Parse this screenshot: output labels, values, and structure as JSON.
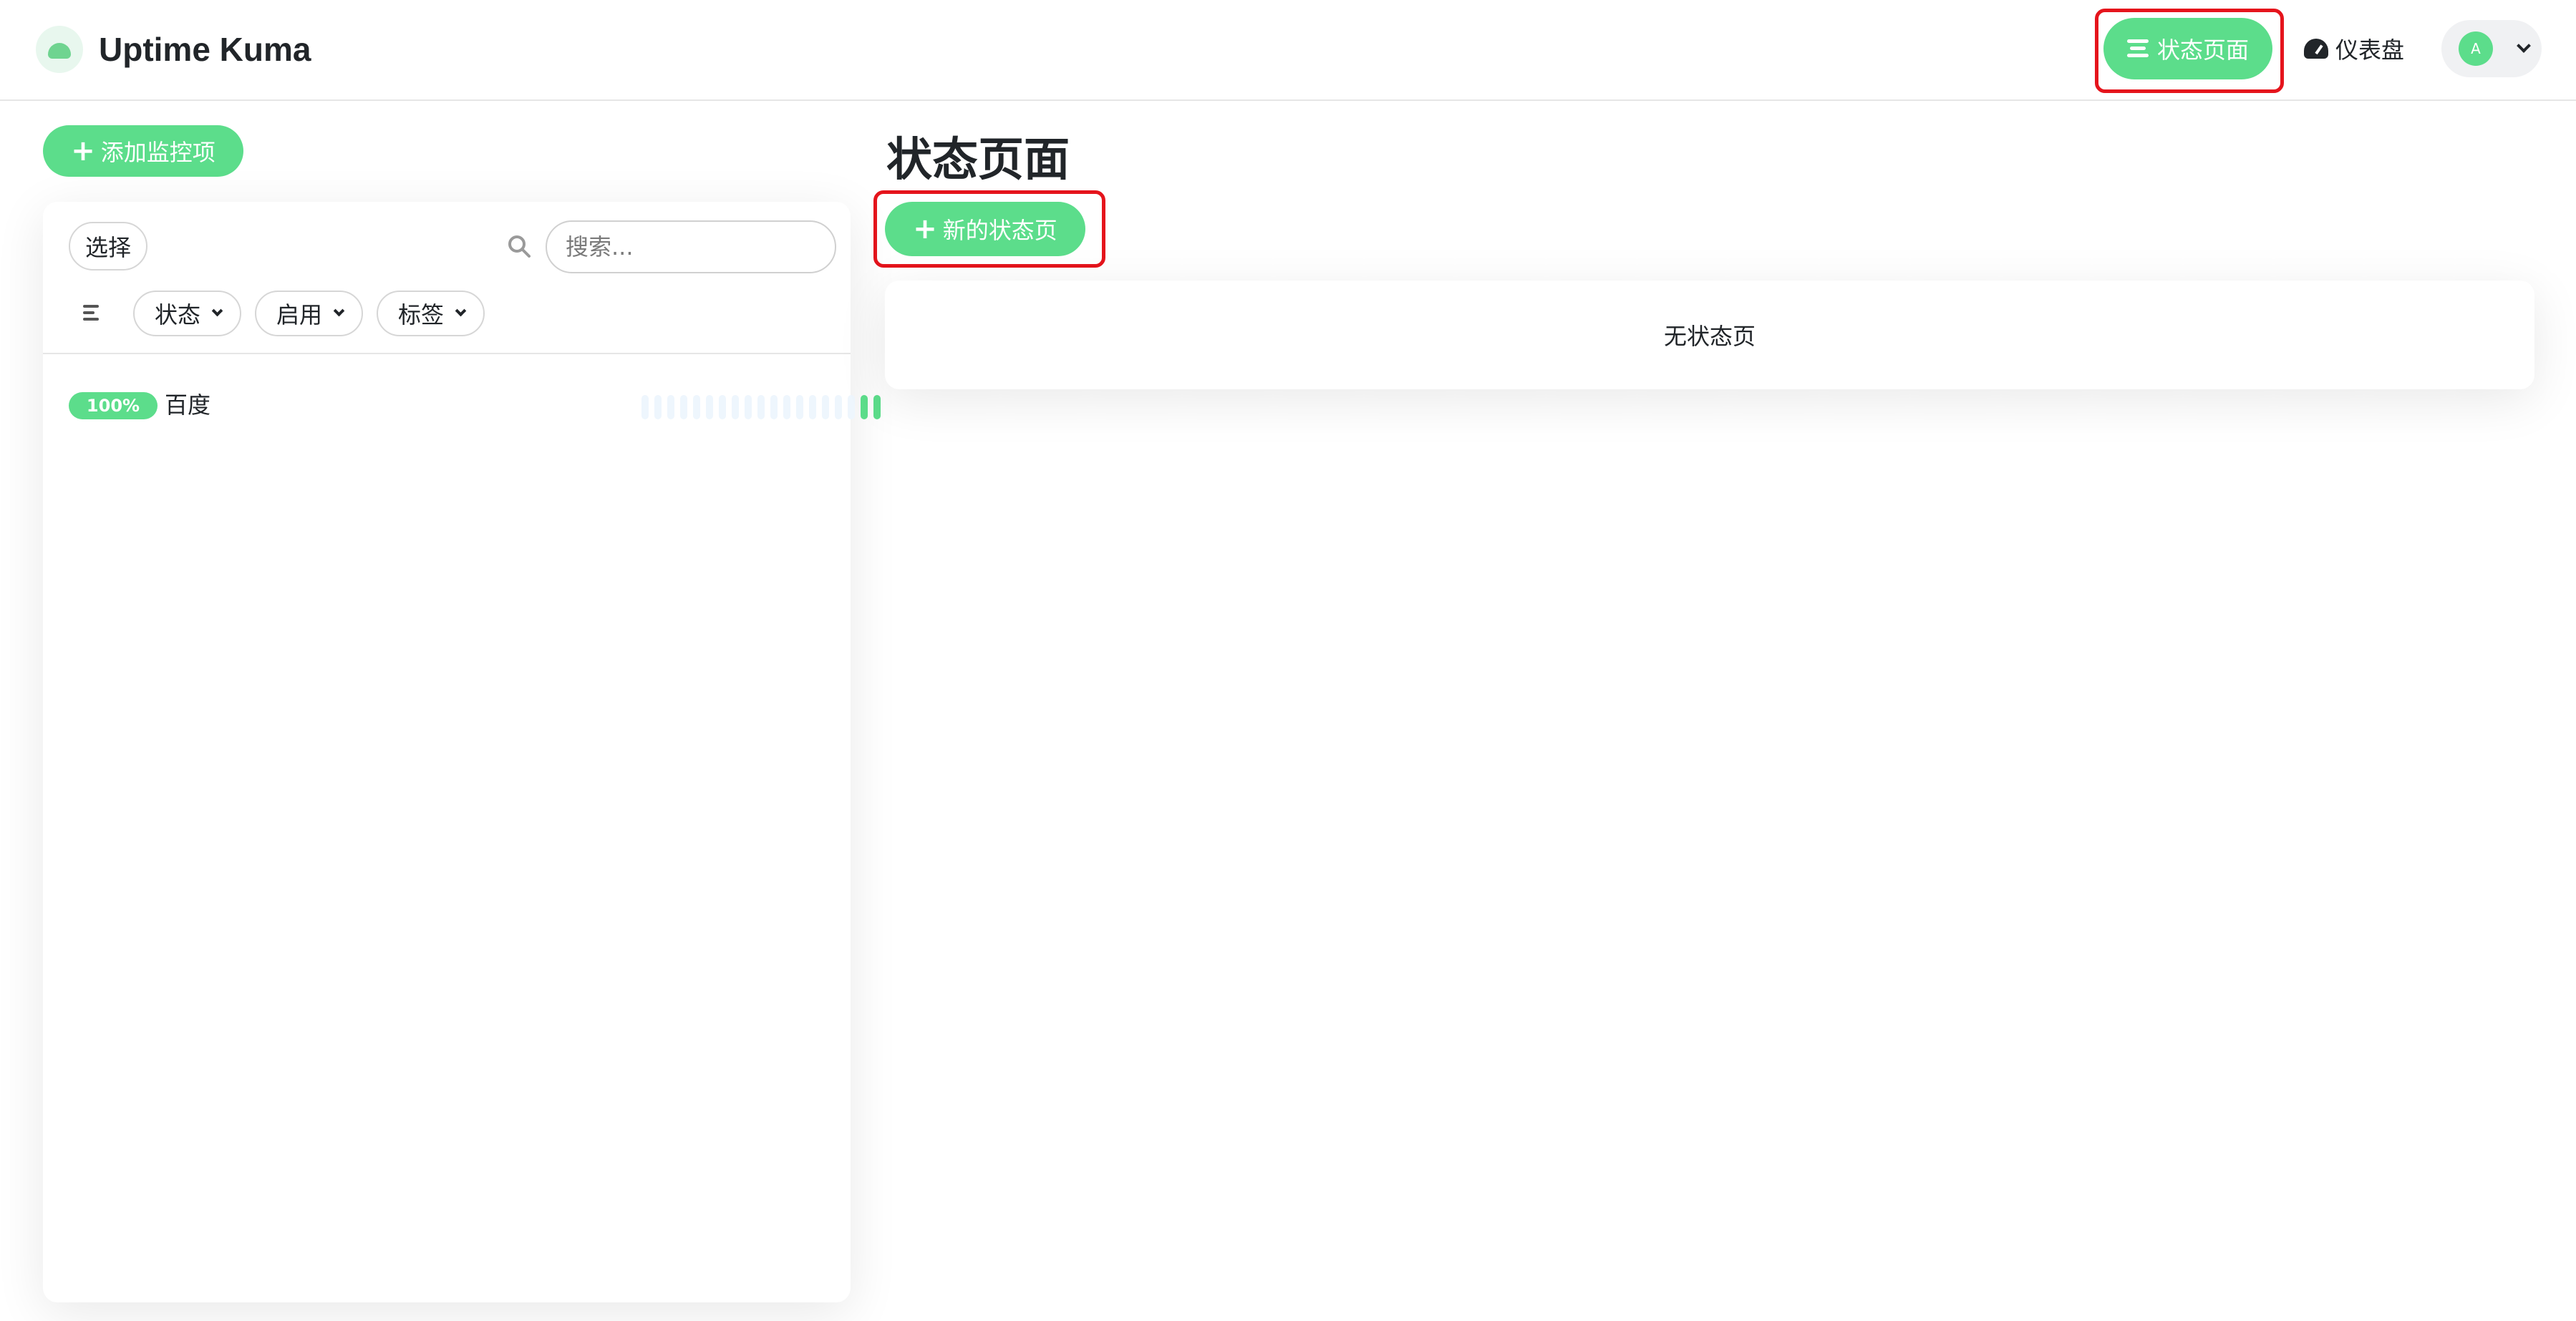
{
  "header": {
    "app_name": "Uptime Kuma",
    "nav_status_pages": "状态页面",
    "nav_dashboard": "仪表盘",
    "avatar_initial": "A"
  },
  "sidebar": {
    "add_monitor_label": "添加监控项",
    "select_label": "选择",
    "search_placeholder": "搜索...",
    "filters": [
      "状态",
      "启用",
      "标签"
    ],
    "monitors": [
      {
        "uptime": "100%",
        "name": "百度"
      }
    ]
  },
  "main": {
    "title": "状态页面",
    "new_status_page_label": "新的状态页",
    "empty_message": "无状态页"
  },
  "colors": {
    "accent": "#5cdd8b",
    "highlight_box": "#e5141c",
    "heartbeat_empty": "#eef6fd"
  },
  "icons": [
    "logo-icon",
    "list-icon",
    "gauge-icon",
    "chevron-down-icon",
    "plus-icon",
    "search-icon",
    "sort-icon"
  ]
}
